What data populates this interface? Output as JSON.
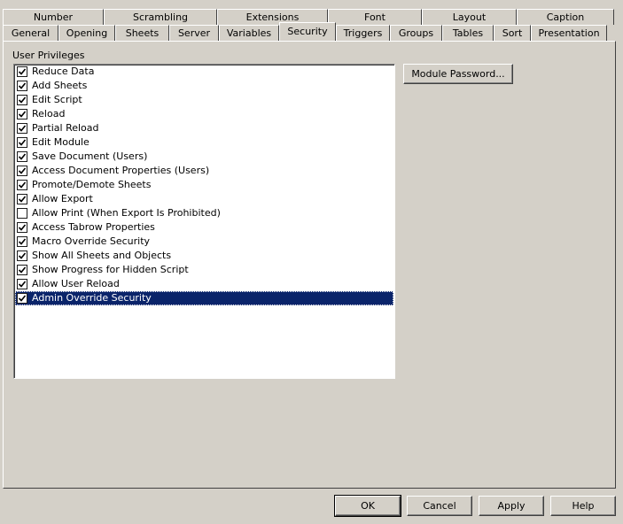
{
  "tabs_back": [
    {
      "label": "Number"
    },
    {
      "label": "Scrambling"
    },
    {
      "label": "Extensions"
    },
    {
      "label": "Font"
    },
    {
      "label": "Layout"
    },
    {
      "label": "Caption"
    }
  ],
  "tabs_front": [
    {
      "label": "General"
    },
    {
      "label": "Opening"
    },
    {
      "label": "Sheets"
    },
    {
      "label": "Server"
    },
    {
      "label": "Variables"
    },
    {
      "label": "Security",
      "active": true
    },
    {
      "label": "Triggers"
    },
    {
      "label": "Groups"
    },
    {
      "label": "Tables"
    },
    {
      "label": "Sort"
    },
    {
      "label": "Presentation"
    }
  ],
  "panel": {
    "group_label": "User Privileges",
    "module_password_label": "Module Password..."
  },
  "privileges": [
    {
      "label": "Reduce Data",
      "checked": true
    },
    {
      "label": "Add Sheets",
      "checked": true
    },
    {
      "label": "Edit Script",
      "checked": true
    },
    {
      "label": "Reload",
      "checked": true
    },
    {
      "label": "Partial Reload",
      "checked": true
    },
    {
      "label": "Edit Module",
      "checked": true
    },
    {
      "label": "Save Document (Users)",
      "checked": true
    },
    {
      "label": "Access Document Properties (Users)",
      "checked": true
    },
    {
      "label": "Promote/Demote Sheets",
      "checked": true
    },
    {
      "label": "Allow Export",
      "checked": true
    },
    {
      "label": "Allow Print (When Export Is Prohibited)",
      "checked": false
    },
    {
      "label": "Access Tabrow Properties",
      "checked": true
    },
    {
      "label": "Macro Override Security",
      "checked": true
    },
    {
      "label": "Show All Sheets and Objects",
      "checked": true
    },
    {
      "label": "Show Progress for Hidden Script",
      "checked": true
    },
    {
      "label": "Allow User Reload",
      "checked": true
    },
    {
      "label": "Admin Override Security",
      "checked": true,
      "selected": true
    }
  ],
  "footer": {
    "ok_label": "OK",
    "cancel_label": "Cancel",
    "apply_label": "Apply",
    "help_label": "Help"
  },
  "colors": {
    "dialog_bg": "#d4d0c8",
    "selection_bg": "#0a246a"
  }
}
